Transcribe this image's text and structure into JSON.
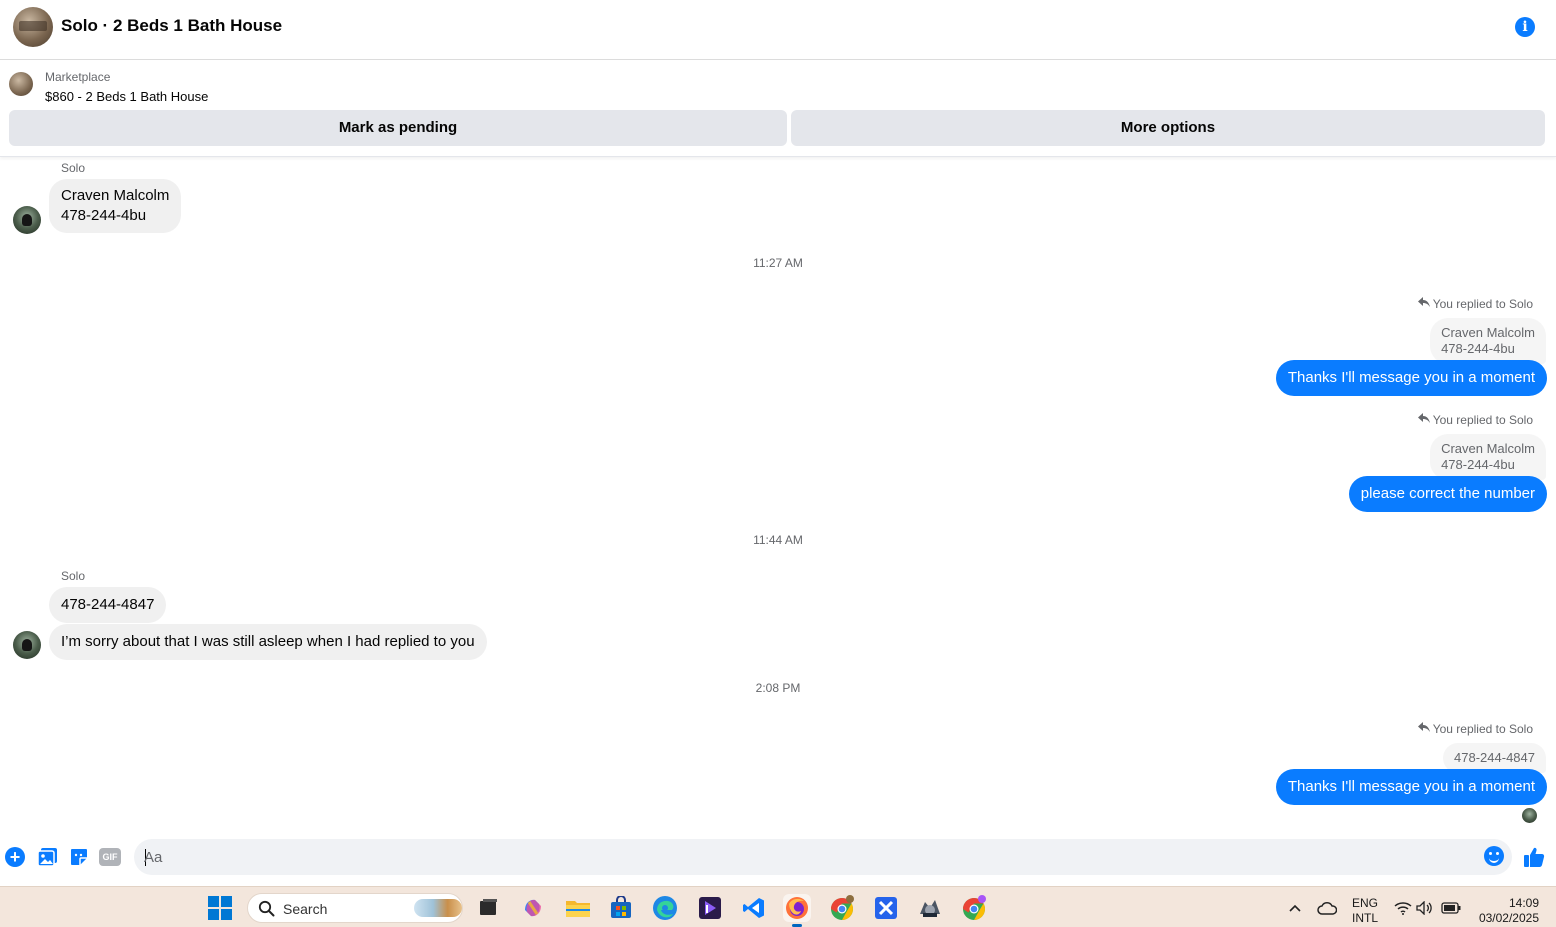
{
  "header": {
    "title": "Solo · 2 Beds 1 Bath House"
  },
  "marketplace": {
    "label": "Marketplace",
    "listing": "$860 - 2 Beds 1 Bath House",
    "pending_button": "Mark as pending",
    "more_button": "More options"
  },
  "messages": {
    "sender1": "Solo",
    "msg1_line1": "Craven Malcolm",
    "msg1_line2": "478-244-4bu",
    "time1": "11:27 AM",
    "reply1_label": "You replied to Solo",
    "reply1_quote_line1": "Craven Malcolm",
    "reply1_quote_line2": "478-244-4bu",
    "reply1_text": "Thanks I'll message you in a moment",
    "reply2_label": "You replied to Solo",
    "reply2_quote_line1": "Craven Malcolm",
    "reply2_quote_line2": "478-244-4bu",
    "reply2_text": "please correct the number",
    "time2": "11:44 AM",
    "sender2": "Solo",
    "msg2_text": "478-244-4847",
    "msg3_text": "I’m sorry about that I was still asleep when I had replied to you",
    "time3": "2:08 PM",
    "reply3_label": "You replied to Solo",
    "reply3_quote": "478-244-4847",
    "reply3_text": "Thanks I'll message you in a moment"
  },
  "composer": {
    "placeholder": "Aa",
    "gif_label": "GIF"
  },
  "taskbar": {
    "search_label": "Search",
    "lang_line1": "ENG",
    "lang_line2": "INTL",
    "time": "14:09",
    "date": "03/02/2025"
  },
  "colors": {
    "accent": "#0a7cff",
    "bubble_in": "#f0f0f0",
    "taskbar_bg": "#f3e6dc"
  },
  "icons": [
    "info-icon",
    "reply-arrow-icon",
    "plus-icon",
    "photo-icon",
    "sticker-icon",
    "gif-icon",
    "emoji-icon",
    "like-icon",
    "windows-start-icon",
    "search-icon",
    "file-explorer-icon",
    "firefox-icon",
    "chrome-icon",
    "wifi-icon",
    "volume-icon",
    "battery-icon"
  ]
}
